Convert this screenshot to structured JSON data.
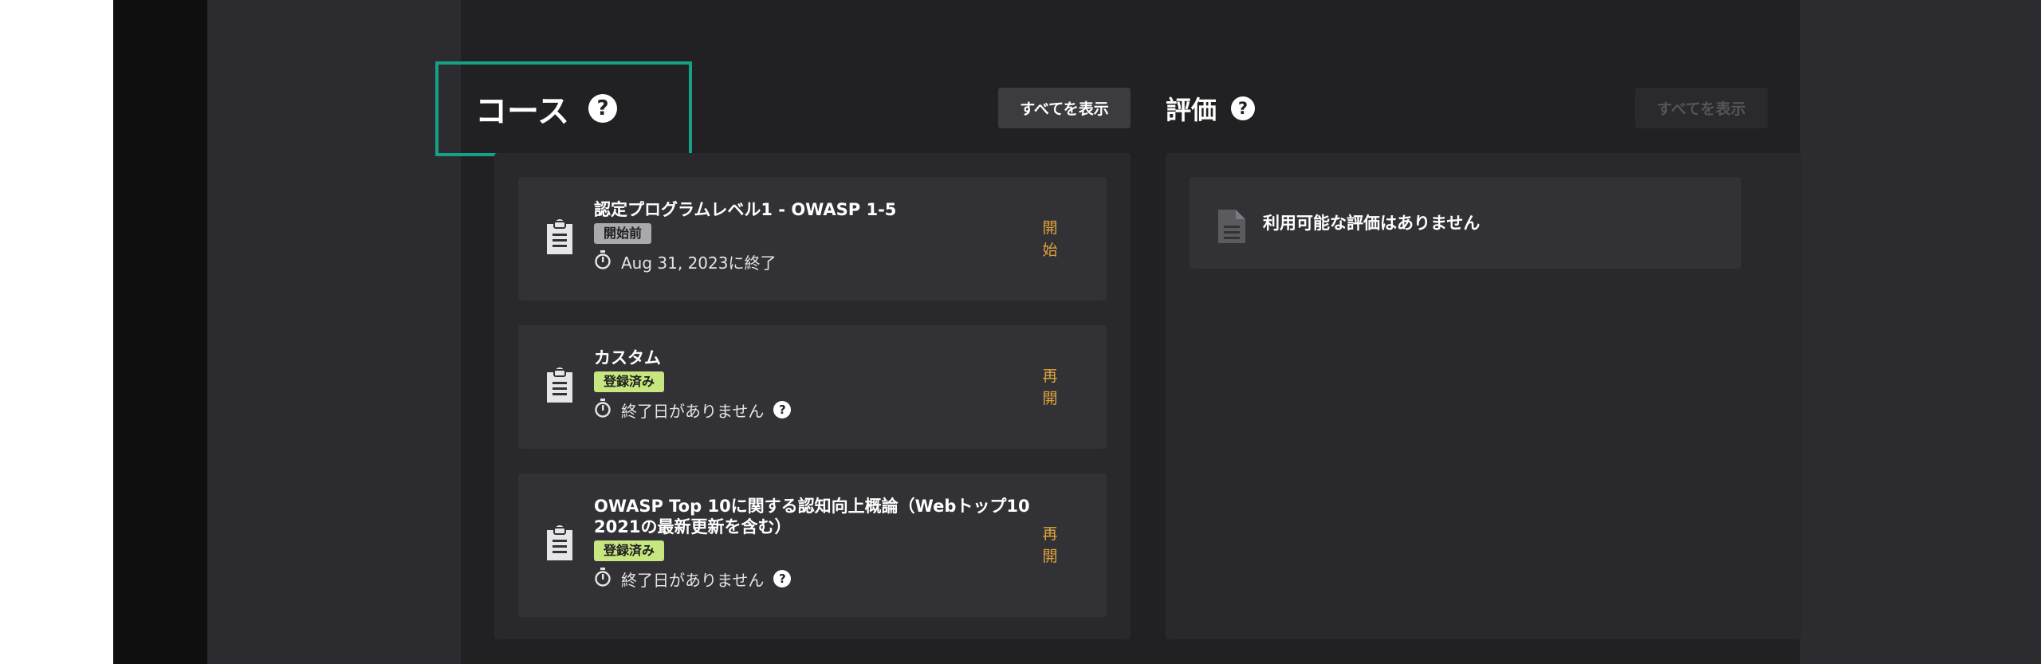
{
  "courses": {
    "title": "コース",
    "view_all": "すべてを表示",
    "items": [
      {
        "title": "認定プログラムレベル1 - OWASP 1-5",
        "badge": "開始前",
        "deadline": "Aug 31, 2023に終了",
        "action": "開始"
      },
      {
        "title": "カスタム",
        "badge": "登録済み",
        "deadline": "終了日がありません",
        "action": "再開"
      },
      {
        "title": "OWASP Top 10に関する認知向上概論（Webトップ10 2021の最新更新を含む）",
        "badge": "登録済み",
        "deadline": "終了日がありません",
        "action": "再開"
      }
    ]
  },
  "evaluations": {
    "title": "評価",
    "view_all": "すべてを表示",
    "empty_message": "利用可能な評価はありません"
  },
  "icons": {
    "help": "question-circle-icon",
    "course": "clipboard-icon",
    "timer": "stopwatch-icon",
    "evaluation": "document-icon"
  },
  "colors": {
    "highlight": "#16a085",
    "action": "#e0a33a",
    "badge_enrolled": "#c6e67f",
    "badge_not_started": "#a9a9ad"
  }
}
